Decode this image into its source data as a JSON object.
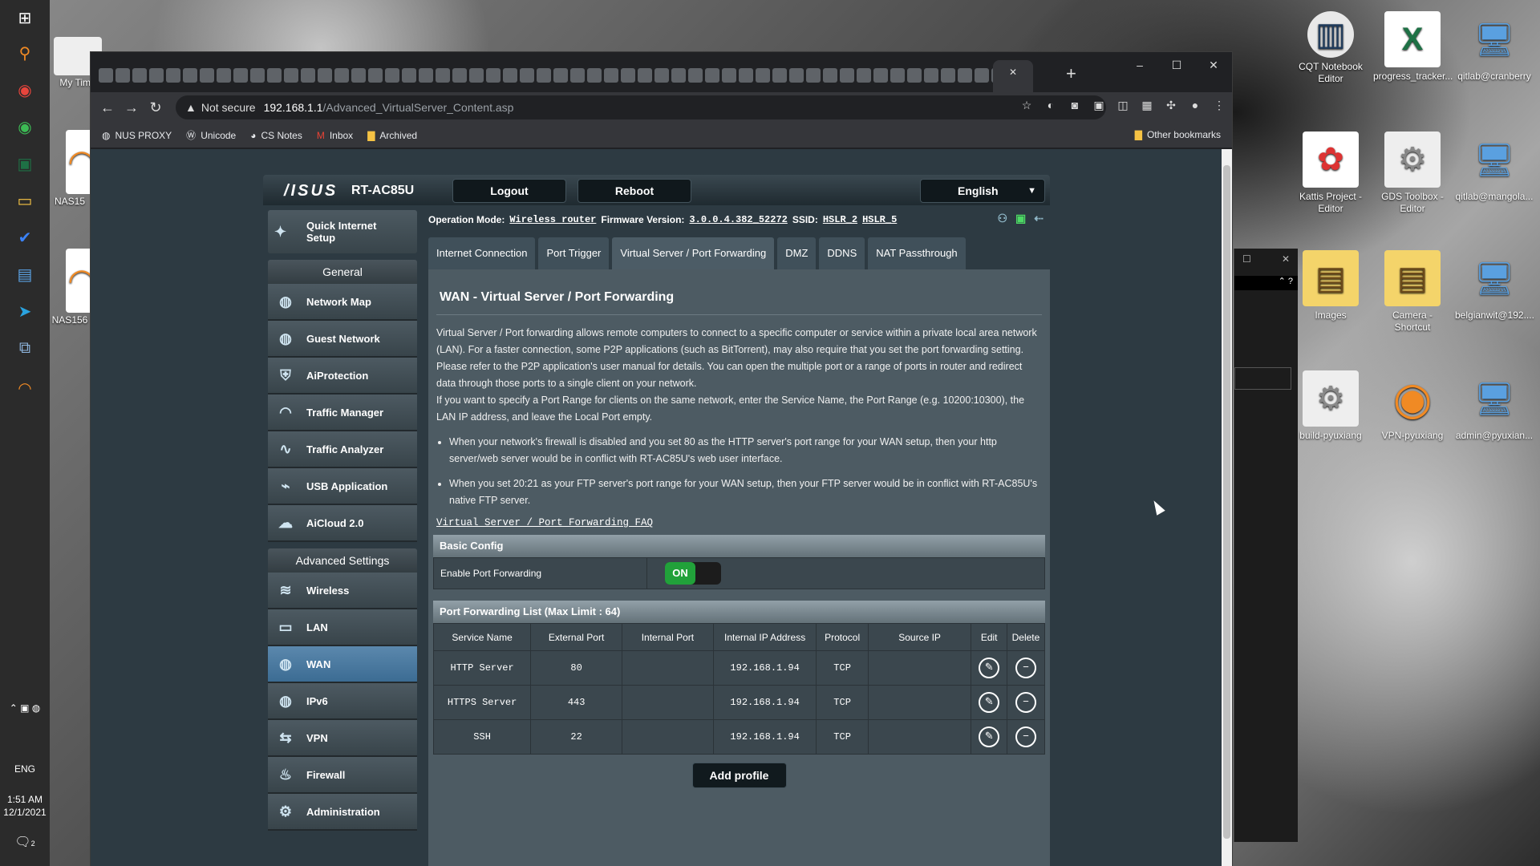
{
  "taskbar": {
    "icons": [
      "windows-icon",
      "search-icon",
      "chrome-icon",
      "chrome-dev-icon",
      "excel-icon",
      "file-explorer-icon",
      "todo-icon",
      "remote-desktop-icon",
      "telegram-icon",
      "network-icon",
      "openvpn-icon"
    ],
    "tray_lang": "ENG",
    "time": "1:51 AM",
    "date": "12/1/2021",
    "notification_count": "2"
  },
  "desktop_left": [
    {
      "label": "My Time"
    },
    {
      "label": "NAS15"
    },
    {
      "label": "NAS156"
    }
  ],
  "desktop_icons": [
    {
      "label": "CQT Notebook Editor",
      "icon": "server-icon"
    },
    {
      "label": "progress_tracker...",
      "icon": "excel-file-icon"
    },
    {
      "label": "qitlab@cranberry",
      "icon": "remote-desktop-icon"
    },
    {
      "label": "Kattis Project - Editor",
      "icon": "kattis-icon"
    },
    {
      "label": "GDS Toolbox - Editor",
      "icon": "gears-icon"
    },
    {
      "label": "qitlab@mangola...",
      "icon": "remote-desktop-icon"
    },
    {
      "label": "Images",
      "icon": "folder-icon"
    },
    {
      "label": "Camera - Shortcut",
      "icon": "folder-icon"
    },
    {
      "label": "belgianwit@192....",
      "icon": "remote-desktop-icon"
    },
    {
      "label": "build-pyuxiang",
      "icon": "gears-icon"
    },
    {
      "label": "VPN-pyuxiang",
      "icon": "openvpn-icon"
    },
    {
      "label": "admin@pyuxian...",
      "icon": "remote-desktop-icon"
    }
  ],
  "browser": {
    "active_tab_close": "✕",
    "new_tab": "+",
    "window_controls": {
      "minimize": "–",
      "maximize": "☐",
      "close": "✕"
    },
    "security_label": "Not secure",
    "url_host": "192.168.1.1",
    "url_path": "/Advanced_VirtualServer_Content.asp",
    "bookmarks": [
      "NUS PROXY",
      "Unicode",
      "CS Notes",
      "Inbox",
      "Archived"
    ],
    "other_bookmarks": "Other bookmarks"
  },
  "router": {
    "brand": "/ISUS",
    "model": "RT-AC85U",
    "logout": "Logout",
    "reboot": "Reboot",
    "language": "English",
    "quick_setup": "Quick Internet Setup",
    "general_heading": "General",
    "general_items": [
      "Network Map",
      "Guest Network",
      "AiProtection",
      "Traffic Manager",
      "Traffic Analyzer",
      "USB Application",
      "AiCloud 2.0"
    ],
    "advanced_heading": "Advanced Settings",
    "advanced_items": [
      "Wireless",
      "LAN",
      "WAN",
      "IPv6",
      "VPN",
      "Firewall",
      "Administration"
    ],
    "active_item": "WAN",
    "op_mode_label": "Operation Mode:",
    "op_mode_value": "Wireless router",
    "fw_label": "Firmware Version:",
    "fw_value": "3.0.0.4.382_52272",
    "ssid_label": "SSID:",
    "ssid_values": [
      "HSLR_2",
      "HSLR_5"
    ],
    "tabs": [
      "Internet Connection",
      "Port Trigger",
      "Virtual Server / Port Forwarding",
      "DMZ",
      "DDNS",
      "NAT Passthrough"
    ],
    "active_tab": "Virtual Server / Port Forwarding",
    "panel_title": "WAN - Virtual Server / Port Forwarding",
    "desc_p1": "Virtual Server / Port forwarding allows remote computers to connect to a specific computer or service within a private local area network (LAN). For a faster connection, some P2P applications (such as BitTorrent), may also require that you set the port forwarding setting. Please refer to the P2P application's user manual for details. You can open the multiple port or a range of ports in router and redirect data through those ports to a single client on your network.",
    "desc_p2": "If you want to specify a Port Range for clients on the same network, enter the Service Name, the Port Range (e.g. 10200:10300), the LAN IP address, and leave the Local Port empty.",
    "bullet1": "When your network's firewall is disabled and you set 80 as the HTTP server's port range for your WAN setup, then your http server/web server would be in conflict with RT-AC85U's web user interface.",
    "bullet2": "When you set 20:21 as your FTP server's port range for your WAN setup, then your FTP server would be in conflict with RT-AC85U's native FTP server.",
    "faq_link": "Virtual Server / Port Forwarding FAQ",
    "basic_config": "Basic Config",
    "enable_pf_label": "Enable Port Forwarding",
    "enable_pf_state": "ON",
    "list_heading": "Port Forwarding List (Max Limit : 64)",
    "columns": [
      "Service Name",
      "External Port",
      "Internal Port",
      "Internal IP Address",
      "Protocol",
      "Source IP",
      "Edit",
      "Delete"
    ],
    "rows": [
      [
        "HTTP Server",
        "80",
        "",
        "192.168.1.94",
        "TCP",
        ""
      ],
      [
        "HTTPS Server",
        "443",
        "",
        "192.168.1.94",
        "TCP",
        ""
      ],
      [
        "SSH",
        "22",
        "",
        "192.168.1.94",
        "TCP",
        ""
      ]
    ],
    "add_profile": "Add profile"
  }
}
